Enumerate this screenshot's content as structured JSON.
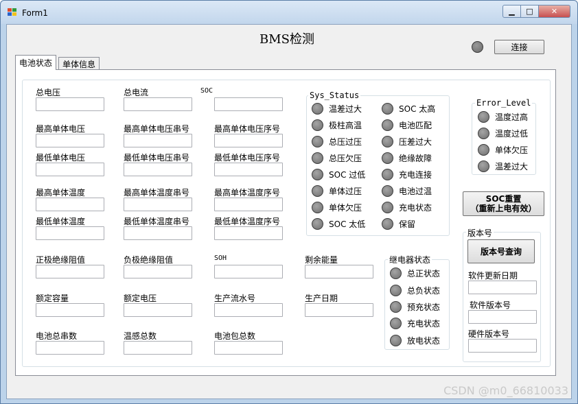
{
  "window": {
    "title": "Form1",
    "min": "▁",
    "max": "□",
    "close": "✕"
  },
  "header": {
    "title": "BMS检测",
    "connect_button": "连接"
  },
  "tabs": [
    {
      "label": "电池状态"
    },
    {
      "label": "单体信息"
    }
  ],
  "fields": {
    "total_voltage": "总电压",
    "total_current": "总电流",
    "soc": "SOC",
    "max_cell_voltage": "最高单体电压",
    "max_cell_voltage_string": "最高单体电压串号",
    "max_cell_voltage_seq": "最高单体电压序号",
    "min_cell_voltage": "最低单体电压",
    "min_cell_voltage_string": "最低单体电压串号",
    "min_cell_voltage_seq": "最低单体电压序号",
    "max_cell_temp": "最高单体温度",
    "max_cell_temp_string": "最高单体温度串号",
    "max_cell_temp_seq": "最高单体温度序号",
    "min_cell_temp": "最低单体温度",
    "min_cell_temp_string": "最低单体温度串号",
    "min_cell_temp_seq": "最低单体温度序号",
    "pos_insulation": "正极绝缘阻值",
    "neg_insulation": "负极绝缘阻值",
    "soh": "SOH",
    "remaining_energy": "剩余能量",
    "rated_capacity": "额定容量",
    "rated_voltage": "额定电压",
    "serial_number": "生产流水号",
    "production_date": "生产日期",
    "total_series": "电池总串数",
    "temp_sensor_count": "温感总数",
    "pack_count": "电池包总数"
  },
  "sys_status": {
    "title": "Sys_Status",
    "left": [
      "温差过大",
      "极柱高温",
      "总压过压",
      "总压欠压",
      "SOC 过低",
      "单体过压",
      "单体欠压",
      "SOC 太低"
    ],
    "right": [
      "SOC 太高",
      "电池匹配",
      "压差过大",
      "绝缘故障",
      "充电连接",
      "电池过温",
      "充电状态",
      "保留"
    ]
  },
  "error_level": {
    "title": "Error_Level",
    "items": [
      "温度过高",
      "温度过低",
      "单体欠压",
      "温差过大"
    ]
  },
  "relay": {
    "title": "继电器状态",
    "items": [
      "总正状态",
      "总负状态",
      "预充状态",
      "充电状态",
      "放电状态"
    ]
  },
  "soc_reset": {
    "line1": "SOC重置",
    "line2": "（重新上电有效）"
  },
  "version": {
    "title": "版本号",
    "query_button": "版本号查询",
    "software_update_date": "软件更新日期",
    "software_version": "软件版本号",
    "hardware_version": "硬件版本号"
  },
  "watermark": "CSDN @m0_66810033"
}
